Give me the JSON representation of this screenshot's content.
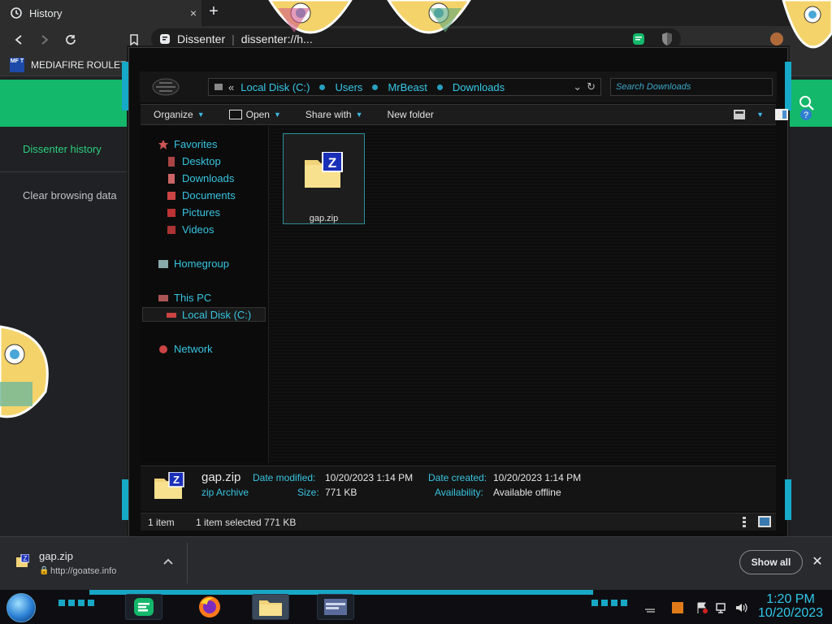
{
  "browser": {
    "tab_title": "History",
    "tab_close": "×",
    "new_tab": "+",
    "site_name": "Dissenter",
    "url_text": "dissenter://h...",
    "bookmark_label": "MEDIAFIRE ROULET...",
    "bookmark_favicon_text": "MF T"
  },
  "page": {
    "nav_history": "Dissenter history",
    "nav_clear": "Clear browsing data"
  },
  "explorer": {
    "address": {
      "overflow": "«",
      "crumbs": [
        "Local Disk (C:)",
        "Users",
        "MrBeast",
        "Downloads"
      ]
    },
    "search_placeholder": "Search Downloads",
    "commands": {
      "organize": "Organize",
      "open": "Open",
      "share": "Share with",
      "new_folder": "New folder"
    },
    "nav": {
      "favorites": "Favorites",
      "desktop": "Desktop",
      "downloads": "Downloads",
      "documents": "Documents",
      "pictures": "Pictures",
      "videos": "Videos",
      "homegroup": "Homegroup",
      "this_pc": "This PC",
      "local_disk": "Local Disk (C:)",
      "network": "Network"
    },
    "file": {
      "name": "gap.zip"
    },
    "details": {
      "name": "gap.zip",
      "type": "zip Archive",
      "modified_label": "Date modified:",
      "modified_value": "10/20/2023 1:14 PM",
      "created_label": "Date created:",
      "created_value": "10/20/2023 1:14 PM",
      "size_label": "Size:",
      "size_value": "771 KB",
      "availability_label": "Availability:",
      "availability_value": "Available offline"
    },
    "status": {
      "count": "1 item",
      "selected": "1 item selected  771 KB"
    }
  },
  "download_shelf": {
    "filename": "gap.zip",
    "source": "http://goatse.info",
    "show_all": "Show all",
    "close": "✕"
  },
  "taskbar": {
    "time": "1:20 PM",
    "date": "10/20/2023"
  },
  "colors": {
    "accent_green": "#13b86a",
    "explorer_cyan": "#37c4e0",
    "clock_cyan": "#2fc7ea"
  }
}
